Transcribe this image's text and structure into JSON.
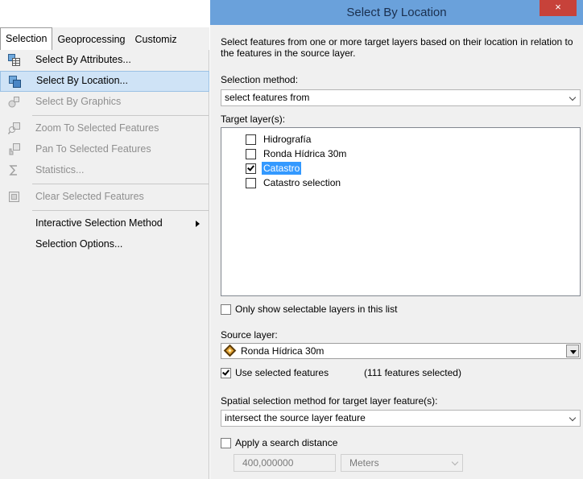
{
  "menu": {
    "tabs": [
      {
        "label": "Selection",
        "active": true
      },
      {
        "label": "Geoprocessing",
        "active": false
      },
      {
        "label": "Customiz",
        "active": false
      }
    ],
    "items": [
      {
        "label": "Select By Attributes...",
        "icon": "table-select-icon",
        "disabled": false
      },
      {
        "label": "Select By Location...",
        "icon": "location-select-icon",
        "disabled": false,
        "hover": true
      },
      {
        "label": "Select By Graphics",
        "icon": "graphics-select-icon",
        "disabled": true
      },
      {
        "label": "Zoom To Selected Features",
        "icon": "zoom-selected-icon",
        "disabled": true
      },
      {
        "label": "Pan To Selected Features",
        "icon": "pan-selected-icon",
        "disabled": true
      },
      {
        "label": "Statistics...",
        "icon": "sigma-icon",
        "disabled": true
      },
      {
        "label": "Clear Selected Features",
        "icon": "clear-selection-icon",
        "disabled": true
      },
      {
        "label": "Interactive Selection Method",
        "disabled": false,
        "submenu": true
      },
      {
        "label": "Selection Options...",
        "disabled": false
      }
    ]
  },
  "dialog": {
    "title": "Select By Location",
    "close_label": "×",
    "description": "Select features from one or more target layers based on their location in relation to the features in the source layer.",
    "selection_method_label": "Selection method:",
    "selection_method_value": "select features from",
    "target_layers_label": "Target layer(s):",
    "target_layers": [
      {
        "name": "Hidrografía",
        "checked": false,
        "selected": false
      },
      {
        "name": "Ronda Hídrica 30m",
        "checked": false,
        "selected": false
      },
      {
        "name": "Catastro",
        "checked": true,
        "selected": true
      },
      {
        "name": "Catastro selection",
        "checked": false,
        "selected": false
      }
    ],
    "only_selectable_label": "Only show selectable layers in this list",
    "only_selectable_checked": false,
    "source_layer_label": "Source layer:",
    "source_layer_value": "Ronda Hídrica 30m",
    "use_selected_label": "Use selected features",
    "use_selected_checked": true,
    "features_selected_text": "(111 features selected)",
    "spatial_method_label": "Spatial selection method for target layer feature(s):",
    "spatial_method_value": "intersect the source layer feature",
    "search_distance_label": "Apply a search distance",
    "search_distance_checked": false,
    "distance_value": "400,000000",
    "distance_unit": "Meters"
  },
  "colors": {
    "titlebar": "#6aa1db",
    "close": "#c7423a",
    "hover": "#cfe3f6",
    "selected_layer": "#3399ff"
  }
}
